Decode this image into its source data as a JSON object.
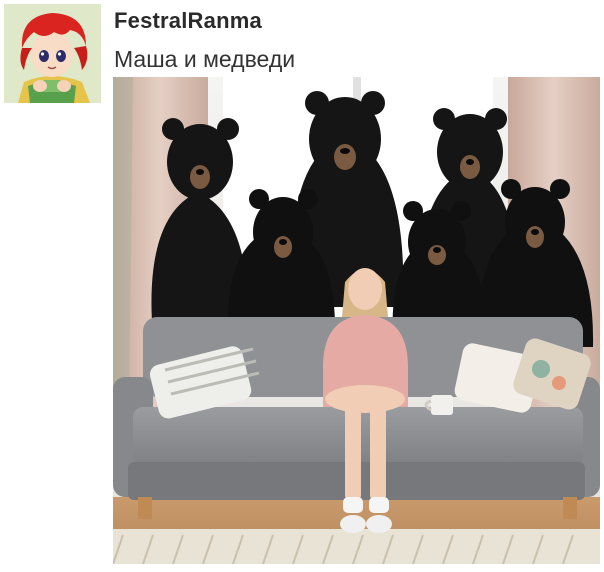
{
  "post": {
    "author": {
      "username": "FestralRanma",
      "avatar_icon": "anime-character-avatar"
    },
    "text": "Маша и медведи",
    "image": {
      "subject": "girl-sitting-on-sofa-with-seven-black-bears",
      "description": "Photo-style picture: a young woman in a pink sweater sits on a gray sofa in a bright room while seven black bears stand behind the sofa."
    }
  },
  "colors": {
    "username": "#2a2a2a",
    "text": "#333333",
    "sofa": "#8d8f92",
    "bear": "#151515",
    "sweater": "#e6aaa4"
  }
}
